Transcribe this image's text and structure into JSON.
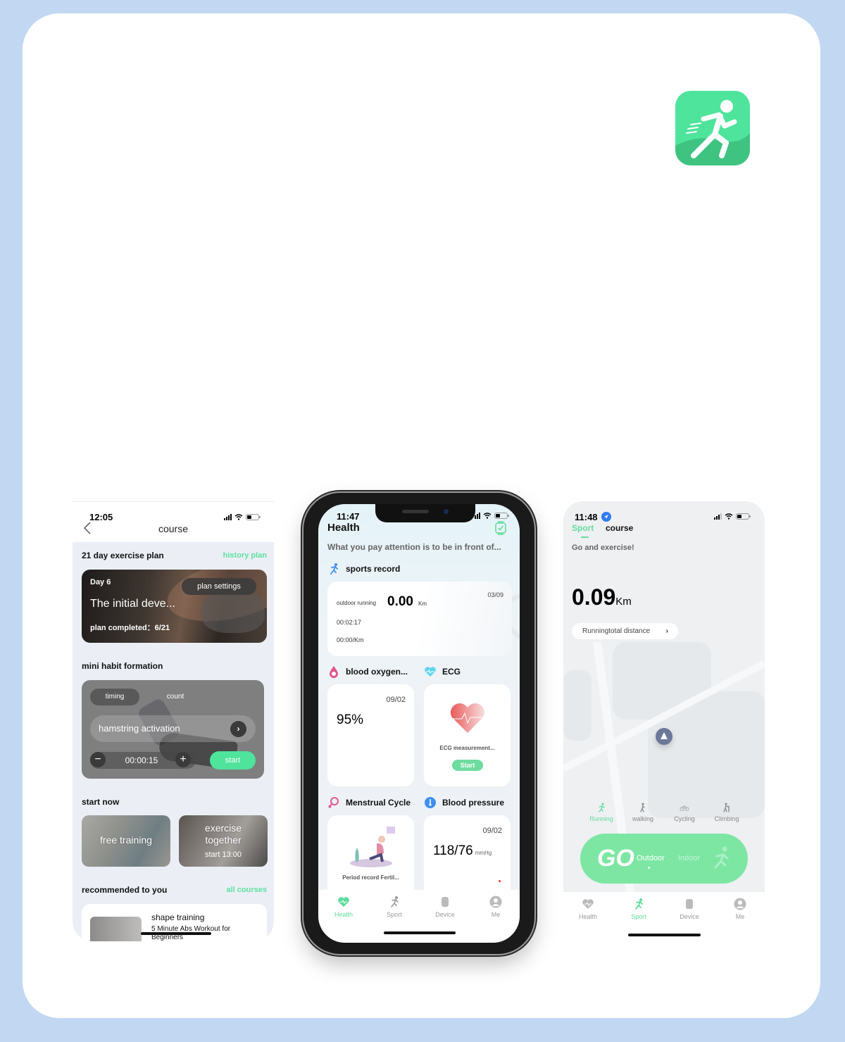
{
  "colors": {
    "background": "#c2d7f1",
    "accent_green": "#4fe39c",
    "go_button": "#7de6a3",
    "link_green": "#5ee0a0"
  },
  "app_icon": {
    "name": "running-app-icon"
  },
  "course_screen": {
    "status_time": "12:05",
    "title": "course",
    "plan_section": {
      "title": "21 day exercise plan",
      "link": "history plan"
    },
    "plan_card": {
      "day": "Day 6",
      "settings_button": "plan settings",
      "name": "The initial deve...",
      "progress": "plan completed：6/21"
    },
    "habit_section": {
      "title": "mini habit formation"
    },
    "habit_card": {
      "tabs": [
        {
          "label": "timing",
          "active": true
        },
        {
          "label": "count",
          "active": false
        }
      ],
      "exercise": "hamstring activation",
      "timer": "00:00:15",
      "minus": "−",
      "plus": "+",
      "start_button": "start",
      "arrow": "›"
    },
    "start_now": {
      "title": "start now",
      "items": [
        {
          "label": "free training"
        },
        {
          "label": "exercise together",
          "sub": "start  13:00"
        }
      ]
    },
    "recommended": {
      "title": "recommended to you",
      "link": "all courses",
      "item": {
        "title": "shape training",
        "subtitle": "5 Minute Abs Workout for Beginners"
      }
    }
  },
  "health_screen": {
    "status_time": "11:47",
    "title": "Health",
    "subtitle": "What you pay attention is to be in front of...",
    "sports_record": {
      "heading": "sports record",
      "type": "outdoor running",
      "distance": "0.00",
      "unit": "Km",
      "date": "03/09",
      "duration": "00:02:17",
      "pace": "00:00/Km"
    },
    "blood_oxygen": {
      "heading": "blood oxygen...",
      "date": "09/02",
      "value": "95%"
    },
    "ecg": {
      "heading": "ECG",
      "label": "ECG measurement...",
      "button": "Start"
    },
    "menstrual": {
      "heading": "Menstrual Cycle",
      "label": "Period record Fertil..."
    },
    "blood_pressure": {
      "heading": "Blood pressure",
      "date": "09/02",
      "value": "118/76",
      "unit": "mmHg"
    },
    "tabbar": [
      {
        "label": "Health",
        "icon": "heart-pulse-icon",
        "active": true
      },
      {
        "label": "Sport",
        "icon": "runner-icon",
        "active": false
      },
      {
        "label": "Device",
        "icon": "watch-icon",
        "active": false
      },
      {
        "label": "Me",
        "icon": "user-icon",
        "active": false
      }
    ]
  },
  "sport_screen": {
    "status_time": "11:48",
    "tabs": [
      {
        "label": "Sport",
        "active": true
      },
      {
        "label": "course",
        "active": false
      }
    ],
    "subtitle": "Go and exercise!",
    "distance": "0.09",
    "unit": "Km",
    "total_button": "Runningtotal distance",
    "chevron": "›",
    "modes": [
      {
        "label": "Running",
        "active": true
      },
      {
        "label": "walking",
        "active": false
      },
      {
        "label": "Cycling",
        "active": false
      },
      {
        "label": "Climbing",
        "active": false
      }
    ],
    "go": {
      "label": "GO",
      "outdoor": "Outdoor",
      "indoor": "Indoor"
    },
    "tabbar": [
      {
        "label": "Health",
        "icon": "heart-pulse-icon",
        "active": false
      },
      {
        "label": "Sport",
        "icon": "runner-icon",
        "active": true
      },
      {
        "label": "Device",
        "icon": "watch-icon",
        "active": false
      },
      {
        "label": "Me",
        "icon": "user-icon",
        "active": false
      }
    ]
  }
}
